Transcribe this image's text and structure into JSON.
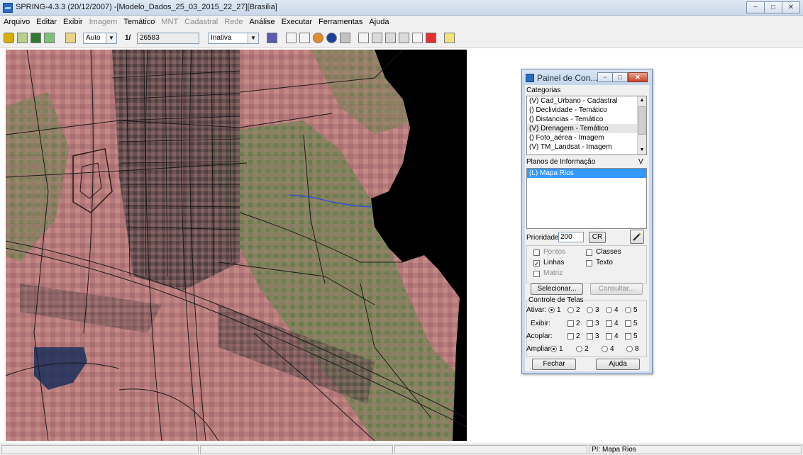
{
  "window": {
    "title": "SPRING-4.3.3 (20/12/2007) -[Modelo_Dados_25_03_2015_22_27][Brasilia]",
    "controls": [
      "−",
      "□",
      "✕"
    ]
  },
  "menu": [
    {
      "label": "Arquivo",
      "enabled": true
    },
    {
      "label": "Editar",
      "enabled": true
    },
    {
      "label": "Exibir",
      "enabled": true
    },
    {
      "label": "Imagem",
      "enabled": false
    },
    {
      "label": "Temático",
      "enabled": true
    },
    {
      "label": "MNT",
      "enabled": false
    },
    {
      "label": "Cadastral",
      "enabled": false
    },
    {
      "label": "Rede",
      "enabled": false
    },
    {
      "label": "Análise",
      "enabled": true
    },
    {
      "label": "Executar",
      "enabled": true
    },
    {
      "label": "Ferramentas",
      "enabled": true
    },
    {
      "label": "Ajuda",
      "enabled": true
    }
  ],
  "toolbar": {
    "scale_mode": "Auto",
    "scale_prefix": "1/",
    "scale_value": "26583",
    "state": "Inativa"
  },
  "status": {
    "plane": "PI: Mapa Rios"
  },
  "panel": {
    "title": "Painel de Con...",
    "categorias_label": "Categorias",
    "categorias": [
      {
        "label": "(V) Cad_Urbano - Cadastral",
        "highlight": false
      },
      {
        "label": "() Declividade - Temático",
        "highlight": false
      },
      {
        "label": "() Distancias - Temático",
        "highlight": false
      },
      {
        "label": "(V) Drenagem - Temático",
        "highlight": true
      },
      {
        "label": "() Foto_aérea - Imagem",
        "highlight": false
      },
      {
        "label": "(V) TM_Landsat - Imagem",
        "highlight": false
      }
    ],
    "planos_label": "Planos de Informação",
    "planos_v": "V",
    "planos": [
      {
        "label": "(L) Mapa Rios",
        "selected": true
      }
    ],
    "prioridade_label": "Prioridade:",
    "prioridade_value": "200",
    "cr_label": "CR",
    "pontos": "Pontos",
    "classes": "Classes",
    "linhas": "Linhas",
    "texto": "Texto",
    "matriz": "Matriz",
    "selecionar": "Selecionar...",
    "consultar": "Consultar...",
    "controle_label": "Controle de Telas",
    "ativar": "Ativar:",
    "exibir": "Exibir:",
    "acoplar": "Acoplar:",
    "ampliar": "Ampliar:",
    "screens": [
      "1",
      "2",
      "3",
      "4",
      "5"
    ],
    "zooms": [
      "1",
      "2",
      "4",
      "8"
    ],
    "fechar": "Fechar",
    "ajuda": "Ajuda"
  }
}
